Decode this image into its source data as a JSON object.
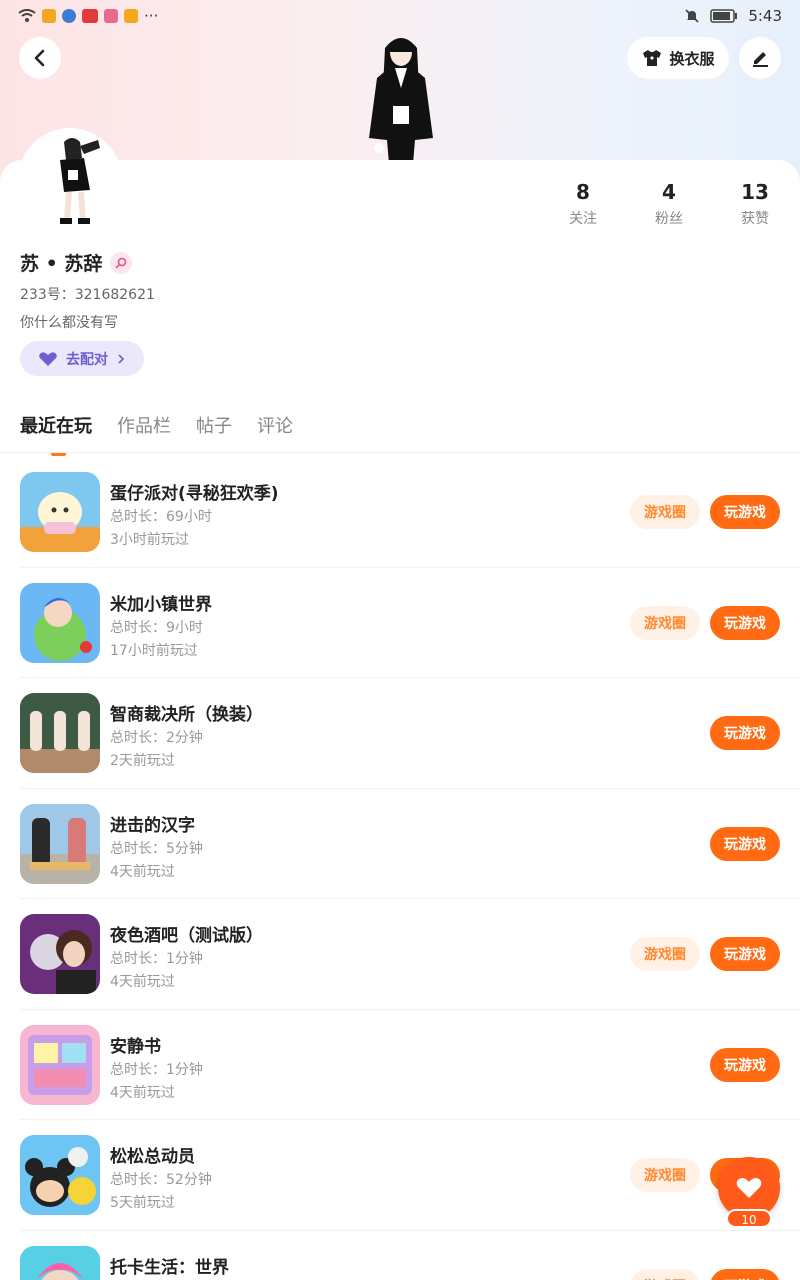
{
  "status_bar": {
    "time": "5:43",
    "dots": "···"
  },
  "header": {
    "dress_label": "换衣服"
  },
  "stats": [
    {
      "num": "8",
      "label": "关注"
    },
    {
      "num": "4",
      "label": "粉丝"
    },
    {
      "num": "13",
      "label": "获赞"
    }
  ],
  "profile": {
    "name": "苏 • 苏辞",
    "uid": "233号：321682621",
    "bio": "你什么都没有写",
    "match_label": "去配对"
  },
  "tabs": [
    "最近在玩",
    "作品栏",
    "帖子",
    "评论"
  ],
  "games": [
    {
      "title": "蛋仔派对(寻秘狂欢季)",
      "duration": "总时长：69小时",
      "last": "3小时前玩过",
      "circle": "游戏圈",
      "play": "玩游戏",
      "icon": "egg-party-icon"
    },
    {
      "title": "米加小镇世界",
      "duration": "总时长：9小时",
      "last": "17小时前玩过",
      "circle": "游戏圈",
      "play": "玩游戏",
      "icon": "miga-town-icon"
    },
    {
      "title": "智商裁决所（换装）",
      "duration": "总时长：2分钟",
      "last": "2天前玩过",
      "circle": "",
      "play": "玩游戏",
      "icon": "iq-court-icon"
    },
    {
      "title": "进击的汉字",
      "duration": "总时长：5分钟",
      "last": "4天前玩过",
      "circle": "",
      "play": "玩游戏",
      "icon": "hanzi-icon"
    },
    {
      "title": "夜色酒吧（测试版）",
      "duration": "总时长：1分钟",
      "last": "4天前玩过",
      "circle": "游戏圈",
      "play": "玩游戏",
      "icon": "night-bar-icon"
    },
    {
      "title": "安静书",
      "duration": "总时长：1分钟",
      "last": "4天前玩过",
      "circle": "",
      "play": "玩游戏",
      "icon": "quiet-book-icon"
    },
    {
      "title": "松松总动员",
      "duration": "总时长：52分钟",
      "last": "5天前玩过",
      "circle": "游戏圈",
      "play": "玩游戏",
      "icon": "tsum-tsum-icon"
    },
    {
      "title": "托卡生活：世界",
      "duration": "",
      "last": "",
      "circle": "游戏圈",
      "play": "玩游戏",
      "icon": "toca-life-icon"
    }
  ],
  "fab": {
    "count": "10"
  },
  "colors": {
    "accent": "#ff6a12",
    "match": "#6b5fd1"
  }
}
